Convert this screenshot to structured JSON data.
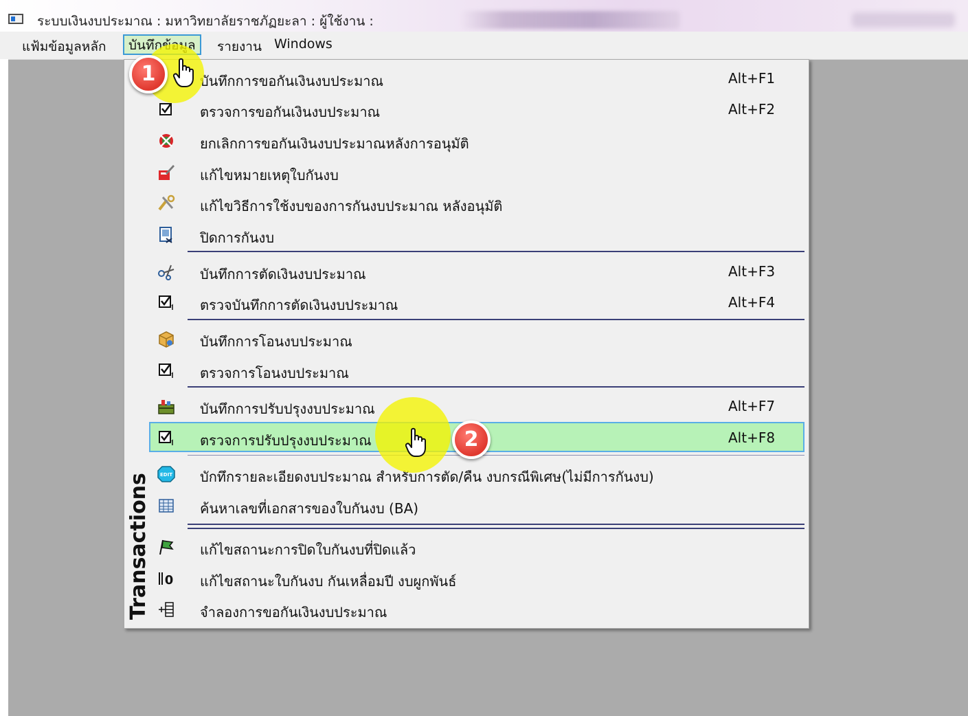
{
  "window": {
    "title": "ระบบเงินงบประมาณ : มหาวิทยาลัยราชภัฏยะลา : ผู้ใช้งาน :"
  },
  "menubar": {
    "items": [
      {
        "label": "แฟ้มข้อมูลหลัก"
      },
      {
        "label": "บันทึกข้อมูล",
        "active": true
      },
      {
        "label": "รายงาน"
      },
      {
        "label": "Windows"
      }
    ]
  },
  "dropdown": {
    "side_label": "Transactions",
    "items": [
      {
        "label": "บันทึกการขอกันเงินงบประมาณ",
        "shortcut": "Alt+F1",
        "icon": "hand-cursor-icon"
      },
      {
        "label": "ตรวจการขอกันเงินงบประมาณ",
        "shortcut": "Alt+F2",
        "icon": "checkbox-icon"
      },
      {
        "label": "ยกเลิกการขอกันเงินงบประมาณหลังการอนุมัติ",
        "shortcut": "",
        "icon": "cancel-globe-icon"
      },
      {
        "label": "แก้ไขหมายเหตุใบกันงบ",
        "shortcut": "",
        "icon": "edit-note-icon"
      },
      {
        "label": "แก้ไขวิธีการใช้งบของการกันงบประมาณ หลังอนุมัติ",
        "shortcut": "",
        "icon": "tools-icon"
      },
      {
        "label": "ปิดการกันงบ",
        "shortcut": "",
        "icon": "close-document-icon"
      },
      {
        "label": "บันทึกการตัดเงินงบประมาณ",
        "shortcut": "Alt+F3",
        "icon": "scissors-icon"
      },
      {
        "label": "ตรวจบันทึกการตัดเงินงบประมาณ",
        "shortcut": "Alt+F4",
        "icon": "checkbox-one-icon"
      },
      {
        "label": "บันทึกการโอนงบประมาณ",
        "shortcut": "",
        "icon": "box-icon"
      },
      {
        "label": "ตรวจการโอนงบประมาณ",
        "shortcut": "",
        "icon": "checkbox-one-icon"
      },
      {
        "label": "บันทึกการปรับปรุงงบประมาณ",
        "shortcut": "Alt+F7",
        "icon": "toolbox-icon"
      },
      {
        "label": "ตรวจการปรับปรุงงบประมาณ",
        "shortcut": "Alt+F8",
        "icon": "checkbox-one-icon",
        "selected": true
      },
      {
        "label": "บักทึกรายละเอียดงบประมาณ  สำหรับการตัด/คืน  งบกรณีพิเศษ(ไม่มีการกันงบ)",
        "shortcut": "",
        "icon": "edit-badge-icon"
      },
      {
        "label": "ค้นหาเลขที่เอกสารของใบกันงบ  (BA)",
        "shortcut": "",
        "icon": "table-grid-icon"
      },
      {
        "label": "แก้ไขสถานะการปิดใบกันงบที่ปิดแล้ว",
        "shortcut": "",
        "icon": "flag-icon"
      },
      {
        "label": "แก้ไขสถานะใบกันงบ กันเหลื่อมปี งบผูกพันธ์",
        "shortcut": "",
        "icon": "status-number-icon"
      },
      {
        "label": "จำลองการขอกันเงินงบประมาณ",
        "shortcut": "",
        "icon": "hierarchy-icon"
      }
    ]
  },
  "annotations": {
    "step1": "1",
    "step2": "2",
    "highlight_color": "#f3f300",
    "badge_color": "#e0392f"
  },
  "colors": {
    "menu_selected_bg": "#b7f2b7",
    "menu_selected_border": "#5aaee6",
    "separator": "#3a3f77",
    "desktop_bg": "#ababab"
  }
}
